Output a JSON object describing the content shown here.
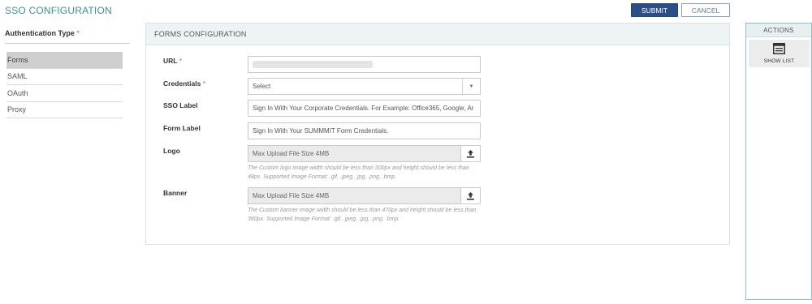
{
  "page_title": "SSO CONFIGURATION",
  "toolbar": {
    "submit_label": "SUBMIT",
    "cancel_label": "CANCEL"
  },
  "auth": {
    "heading": "Authentication Type",
    "required_mark": "*",
    "items": [
      {
        "label": "Forms",
        "active": true
      },
      {
        "label": "SAML",
        "active": false
      },
      {
        "label": "OAuth",
        "active": false
      },
      {
        "label": "Proxy",
        "active": false
      }
    ]
  },
  "forms": {
    "header": "FORMS CONFIGURATION",
    "url": {
      "label": "URL",
      "required_mark": "*",
      "value": ""
    },
    "credentials": {
      "label": "Credentials",
      "required_mark": "*",
      "value": "Select",
      "arrow_icon": "caret-down-icon"
    },
    "sso_label": {
      "label": "SSO Label",
      "value": "Sign In With Your Corporate Credentials. For Example: Office365, Google, Ar"
    },
    "form_label": {
      "label": "Form Label",
      "value": "Sign In With Your SUMMMIT Form Credentials."
    },
    "logo": {
      "label": "Logo",
      "value": "Max Upload File Size 4MB",
      "hint": "The Custom logo image width should be less than 300px and height should be less than 48px. Supported Image Format: .gif, .jpeg, .jpg, .png, .bmp."
    },
    "banner": {
      "label": "Banner",
      "value": "Max Upload File Size 4MB",
      "hint": "The Custom banner image width should be less than 470px and height should be less than 360px. Supported Image Format: .gif, .jpeg, .jpg, .png, .bmp."
    }
  },
  "actions": {
    "header": "ACTIONS",
    "show_list_label": "SHOW LIST",
    "show_list_icon": "list-icon"
  },
  "colors": {
    "title": "#3c8fa0",
    "submit_bg": "#2b4e86",
    "required": "#d9534f",
    "panel_border": "#8bc3c4"
  }
}
